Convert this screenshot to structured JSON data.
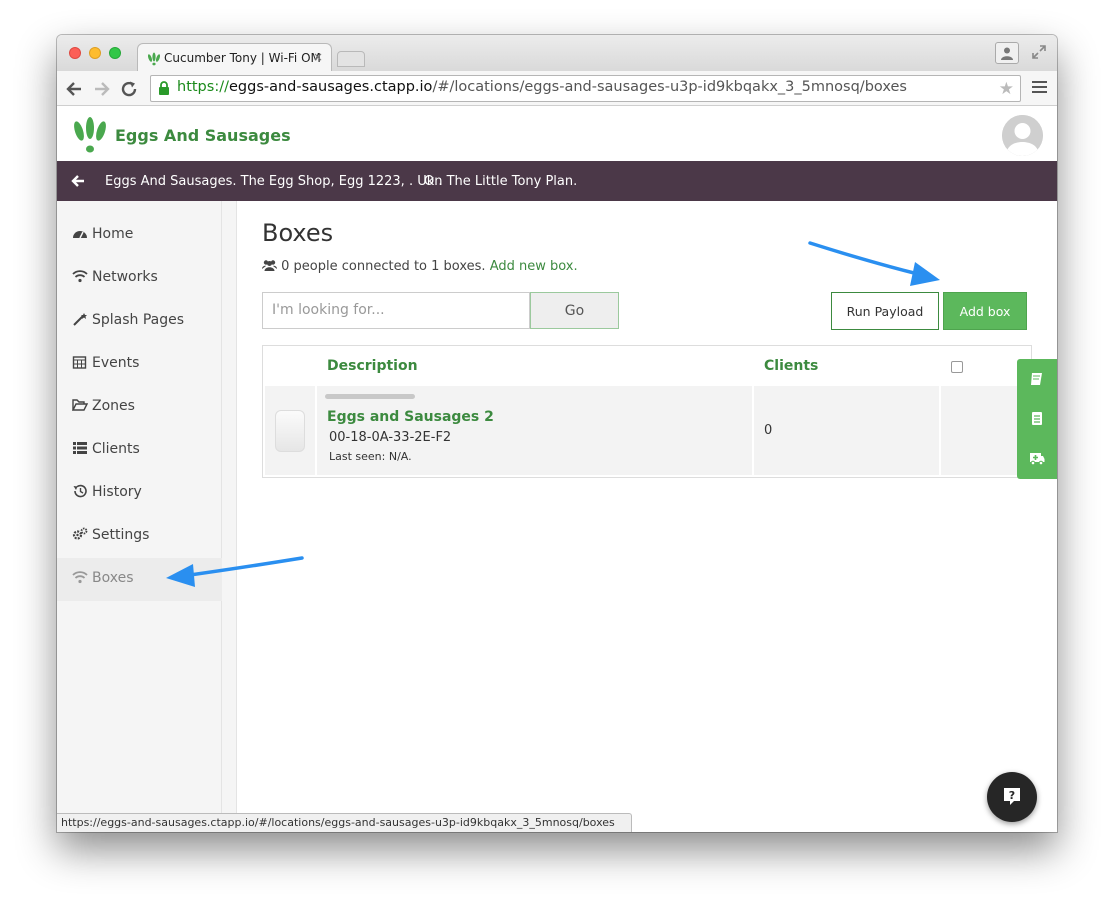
{
  "browser": {
    "tab_title": "Cucumber Tony | Wi-Fi OM",
    "tab_close": "×",
    "url_scheme": "https://",
    "url_host": "eggs-and-sausages.ctapp.io",
    "url_path": "/#/locations/eggs-and-sausages-u3p-id9kbqakx_3_5mnosq/boxes",
    "status_url": "https://eggs-and-sausages.ctapp.io/#/locations/eggs-and-sausages-u3p-id9kbqakx_3_5mnosq/boxes"
  },
  "header": {
    "brand": "Eggs And Sausages",
    "location_text": "Eggs And Sausages. The Egg Shop, Egg 1223, . Uk .",
    "plan_text": "On The Little Tony Plan."
  },
  "sidebar": {
    "items": [
      {
        "label": "Home",
        "icon": "dashboard-icon"
      },
      {
        "label": "Networks",
        "icon": "wifi-icon"
      },
      {
        "label": "Splash Pages",
        "icon": "magic-wand-icon"
      },
      {
        "label": "Events",
        "icon": "calendar-icon"
      },
      {
        "label": "Zones",
        "icon": "folder-open-icon"
      },
      {
        "label": "Clients",
        "icon": "list-icon"
      },
      {
        "label": "History",
        "icon": "history-icon"
      },
      {
        "label": "Settings",
        "icon": "gears-icon"
      },
      {
        "label": "Boxes",
        "icon": "wifi-icon",
        "active": true
      }
    ]
  },
  "main": {
    "title": "Boxes",
    "summary_text": "0 people connected to 1 boxes.",
    "add_new_link": "Add new box.",
    "search_placeholder": "I'm looking for...",
    "go_label": "Go",
    "run_payload_label": "Run Payload",
    "add_box_label": "Add box",
    "table": {
      "columns": [
        "Description",
        "Clients"
      ],
      "rows": [
        {
          "name": "Eggs and Sausages 2",
          "mac": "00-18-0A-33-2E-F2",
          "last_seen": "Last seen: N/A.",
          "clients": "0"
        }
      ]
    }
  },
  "colors": {
    "brand_green": "#3c8a3f",
    "button_green": "#5cb85c",
    "location_bar": "#4b3848",
    "annotation_arrow": "#2a8ff0"
  }
}
